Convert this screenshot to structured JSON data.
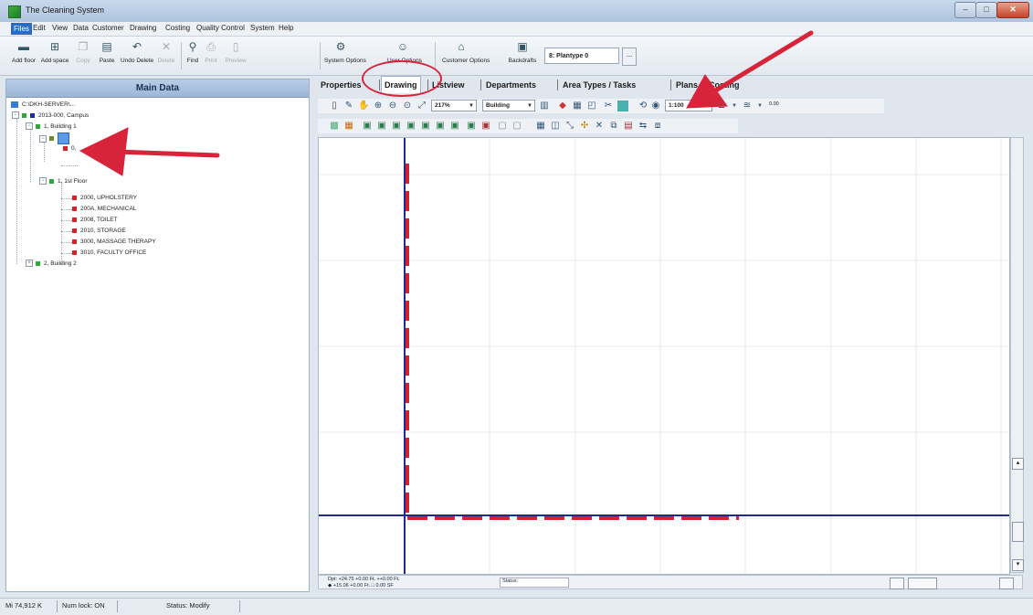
{
  "window": {
    "title": "The Cleaning System",
    "buttons": {
      "minimize": "–",
      "maximize": "□",
      "close": "✕"
    }
  },
  "menu": [
    "Files",
    "Edit",
    "View",
    "Data",
    "Customer",
    "Drawing",
    "Costing",
    "Quality Control",
    "System",
    "Help"
  ],
  "toolbar": {
    "buttons": [
      {
        "label": "Add floor",
        "icon": "add-floor-icon",
        "glyph": "▬",
        "enabled": true
      },
      {
        "label": "Add space",
        "icon": "add-space-icon",
        "glyph": "⊞",
        "enabled": true
      },
      {
        "label": "Copy",
        "icon": "copy-icon",
        "glyph": "❐",
        "enabled": false
      },
      {
        "label": "Paste",
        "icon": "paste-icon",
        "glyph": "▤",
        "enabled": true
      },
      {
        "label": "Undo Delete",
        "icon": "undo-icon",
        "glyph": "↶",
        "enabled": true
      },
      {
        "label": "Delete",
        "icon": "delete-icon",
        "glyph": "✕",
        "enabled": false
      },
      {
        "label": "Find",
        "icon": "binoculars-icon",
        "glyph": "⚲",
        "enabled": true
      },
      {
        "label": "Print",
        "icon": "print-icon",
        "glyph": "⎙",
        "enabled": false
      },
      {
        "label": "Preview",
        "icon": "preview-icon",
        "glyph": "▯",
        "enabled": false
      },
      {
        "label": "System Options",
        "icon": "system-options-icon",
        "glyph": "⚙",
        "enabled": true
      },
      {
        "label": "User Options",
        "icon": "user-options-icon",
        "glyph": "☺",
        "enabled": true
      },
      {
        "label": "Customer Options",
        "icon": "customer-options-icon",
        "glyph": "⌂",
        "enabled": true
      },
      {
        "label": "Backdrafts",
        "icon": "backdrafts-icon",
        "glyph": "▣",
        "enabled": true
      }
    ],
    "plantype_value": "8: Plantype 0",
    "plantype_more": "..."
  },
  "left_panel": {
    "header": "Main Data",
    "server": "C:\\DKH-SERVER\\...",
    "tree": [
      {
        "label": "2013-000, Campus",
        "color": "blue",
        "toggle": "−"
      },
      {
        "label": "1, Building 1",
        "color": "green",
        "toggle": "−"
      },
      {
        "label": "0,",
        "color": "olive",
        "toggle": "−",
        "selected": true
      },
      {
        "label": "0,",
        "color": "red",
        "toggle": ""
      },
      {
        "label": "1, 1st Floor",
        "color": "green",
        "toggle": "−"
      },
      {
        "label": "2000, UPHOLSTERY",
        "color": "red",
        "toggle": ""
      },
      {
        "label": "200A, MECHANICAL",
        "color": "red",
        "toggle": ""
      },
      {
        "label": "2008, TOILET",
        "color": "red",
        "toggle": ""
      },
      {
        "label": "2010, STORAGE",
        "color": "red",
        "toggle": ""
      },
      {
        "label": "3000, MASSAGE THERAPY",
        "color": "red",
        "toggle": ""
      },
      {
        "label": "3010, FACULTY OFFICE",
        "color": "red",
        "toggle": ""
      },
      {
        "label": "2, Building 2",
        "color": "green",
        "toggle": "+"
      }
    ]
  },
  "tabs": [
    "Properties",
    "Drawing",
    "Listview",
    "Departments",
    "Area Types / Tasks",
    "Plans",
    "Costing"
  ],
  "active_tab": "Drawing",
  "drawing_toolbar": {
    "zoom": "217%",
    "layer": "Building",
    "scale": "1:100",
    "small_value": "0.00"
  },
  "coords": {
    "line1": "Dpt: +24.75   +0.00 Ft.   ++0.00 Ft.",
    "line2": "  ◆ +15.06   +0.00 Ft.   □ 0.00 SF",
    "status_label": "Status:"
  },
  "statusbar": {
    "memory": "Mi 74,912 K",
    "numlock": "Num lock: ON",
    "status": "Status: Modify"
  },
  "colors": {
    "axis": "#1e2a8c",
    "wall": "#d9202a",
    "annotation": "#d8243a",
    "selected": "#5b9be6"
  }
}
